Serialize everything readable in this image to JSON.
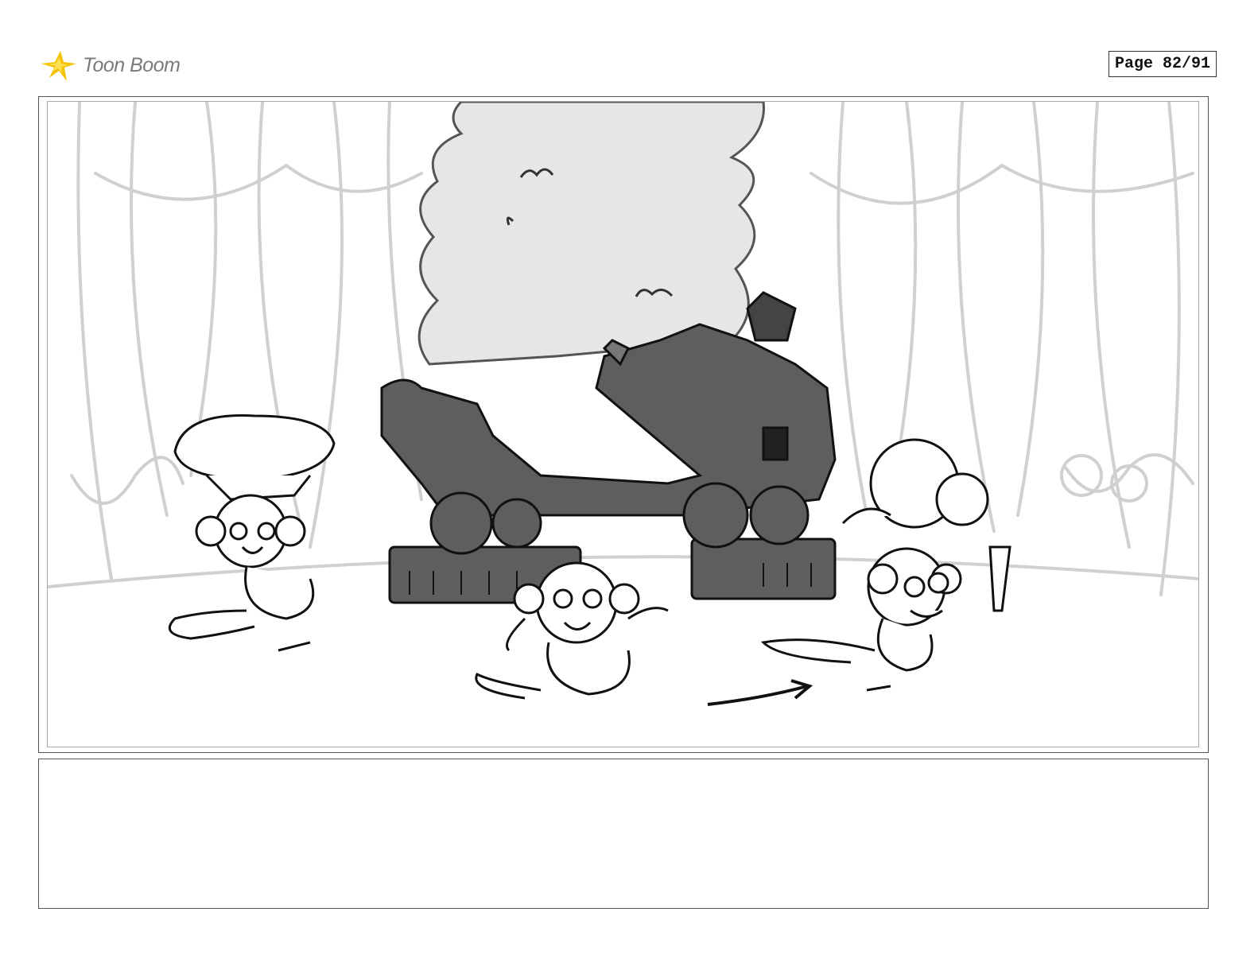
{
  "header": {
    "logo_text": "Toon Boom",
    "logo_color": "#f2c200",
    "page_label": "Page 82/91"
  },
  "panel": {
    "image_description_icon": "storyboard-sketch",
    "contents": [
      "curtain-backdrop",
      "smoke-cloud",
      "wrecked-cart",
      "monkey-left",
      "monkey-center",
      "monkey-right"
    ],
    "colors": {
      "sketch_line": "#111111",
      "curtain_line": "#cfcfcf",
      "smoke_fill": "#e6e6e6",
      "cart_fill": "#5e5e5e"
    }
  },
  "notes": {
    "text": ""
  }
}
